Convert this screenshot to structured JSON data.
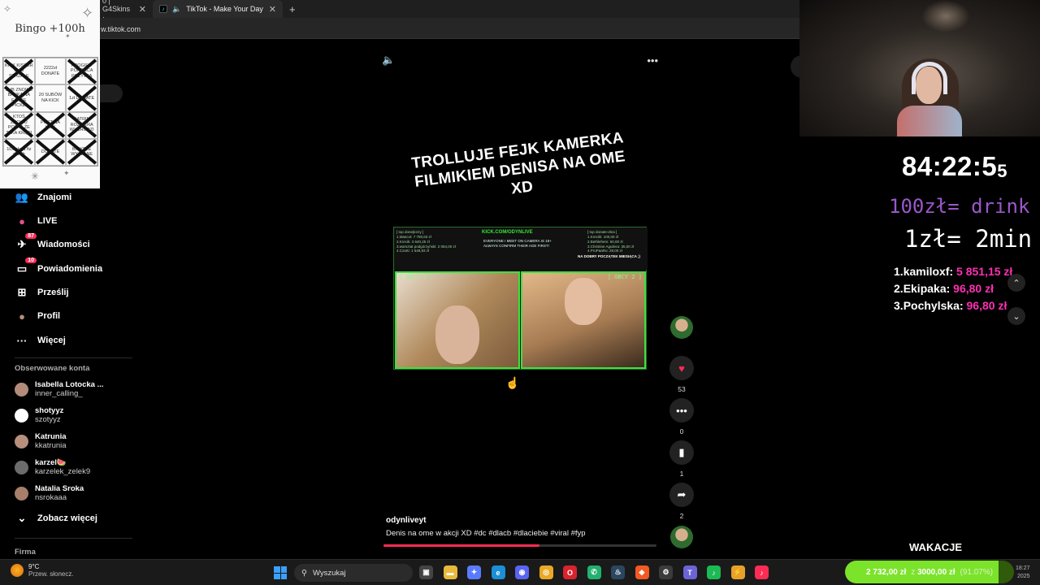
{
  "browser": {
    "tabs": [
      {
        "title": "0 | G4Skins ·",
        "active": false
      },
      {
        "title": "TikTok - Make Your Day",
        "active": true
      }
    ],
    "new_tab": "+",
    "url": "w.tiktok.com"
  },
  "bingo": {
    "title": "Bingo +100h",
    "cells": [
      {
        "text": "KICK KISSER O 10 STRZALE",
        "crossed": true
      },
      {
        "text": "2222zł DONATE",
        "crossed": false
      },
      {
        "text": "PROGIE 7 POKONCA POZYWIA",
        "crossed": true
      },
      {
        "text": "SUB ZNOWU BAŃKA NA FANCE PICKE",
        "crossed": true
      },
      {
        "text": "20 SUBÓW NA KICK",
        "crossed": false
      },
      {
        "text": "1zł DONATE",
        "crossed": true
      },
      {
        "text": "KTOŚ ZNOWU POWIE ŻE TAKA KRĘCI",
        "crossed": true
      },
      {
        "text": "POST NA KICK",
        "crossed": true
      },
      {
        "text": "KATRIN ROZBIERA WYCHODZI",
        "crossed": true
      },
      {
        "text": "10x akcja fiz dla lib",
        "crossed": true
      },
      {
        "text": "DONATE",
        "crossed": true
      },
      {
        "text": "BICYSLE WYSŁANE",
        "crossed": true
      }
    ]
  },
  "sidebar": {
    "nav": [
      {
        "label": "Znajomi",
        "icon": "friends-icon",
        "glyph": "👥",
        "badge": ""
      },
      {
        "label": "LIVE",
        "icon": "live-icon",
        "glyph": "●",
        "badge": ""
      },
      {
        "label": "Wiadomości",
        "icon": "messages-icon",
        "glyph": "✈",
        "badge": "87"
      },
      {
        "label": "Powiadomienia",
        "icon": "inbox-icon",
        "glyph": "▭",
        "badge": "10"
      },
      {
        "label": "Prześlij",
        "icon": "upload-icon",
        "glyph": "⊞",
        "badge": ""
      },
      {
        "label": "Profil",
        "icon": "profile-icon",
        "glyph": "●",
        "badge": ""
      },
      {
        "label": "Więcej",
        "icon": "more-icon",
        "glyph": "···",
        "badge": ""
      }
    ],
    "following_title": "Obserwowane konta",
    "following": [
      {
        "name": "Isabella Lotocka ...",
        "handle": "inner_calling_",
        "color": "#b48b7a"
      },
      {
        "name": "shotyyz",
        "handle": "szotyyz",
        "color": "#ffffff"
      },
      {
        "name": "Katrunia",
        "handle": "kkatrunia",
        "color": "#b78f7d"
      },
      {
        "name": "karzel🍉",
        "handle": "karzelek_zelek9",
        "color": "#6c6c6c"
      },
      {
        "name": "Natalia Sroka",
        "handle": "nsrokaaa",
        "color": "#a77f6a"
      }
    ],
    "see_more": "Zobacz więcej",
    "company": "Firma"
  },
  "video": {
    "headline": "TROLLUJE FEJK KAMERKA FILMIKIEM DENISA NA OME XD",
    "inner": {
      "kick_banner": "KICK.COM/ODYNLIVE",
      "left_board": "[ top donejtorzy ]\n1.Mascot: 7 790,63 zł\n2.Krecik: 3 640,25 zł\n3.warsztat podgórzyński: 2 054,00 zł\n4.Czarti: 1 549,83 zł",
      "right_board": "[ top donate-dnia ]\n1.Kreciik: 100,00 zł\n2.Bethlehem: 60,00 zł\n3.Christine Aguilera: 35,00 zł\n4.ProPaaRo: 28,00 zł",
      "notice": "EVERYONE I MEET ON CAMERA IS 18+\nALWAYS CONFIRM THEIR AGE FIRST!",
      "mission": "NA DOBRY POCZĄTEK MIESIĄCA ;)",
      "cam_left": "[ OBCY 1 ]",
      "cam_right": "[ OBCY 2 ]"
    },
    "author": "odynliveyt",
    "caption": "Denis na ome w akcji XD #dc  #dlacb  #dlaciebie  #viral  #fyp",
    "progress": 0.57
  },
  "actions": [
    {
      "name": "like",
      "icon": "heart-icon",
      "glyph": "♥",
      "count": "53"
    },
    {
      "name": "comment",
      "icon": "comment-icon",
      "glyph": "•••",
      "count": "0"
    },
    {
      "name": "save",
      "icon": "bookmark-icon",
      "glyph": "▮",
      "count": "1"
    },
    {
      "name": "share",
      "icon": "share-icon",
      "glyph": "➦",
      "count": "2"
    }
  ],
  "stream": {
    "timer": "84:22:5",
    "timer_tail": "5",
    "drink_line": "100zł= drink",
    "rate_line": "1zł= 2min",
    "top": [
      {
        "rank": "1.",
        "name": "kamiloxf:",
        "amount": "5 851,15 zł"
      },
      {
        "rank": "2.",
        "name": "Ekipaka:",
        "amount": "96,80 zł"
      },
      {
        "rank": "3.",
        "name": "Pochylska:",
        "amount": "96,80 zł"
      }
    ],
    "wakacje": "WAKACJE",
    "goal": {
      "raised": "2 732,00 zł",
      "of": "z",
      "target": "3000,00 zł",
      "percent_label": "(91.07%)",
      "fraction": 0.9107
    }
  },
  "taskbar": {
    "temp": "9°C",
    "weather_desc": "Przew. słonecz.",
    "search_placeholder": "Wyszukaj",
    "apps": [
      {
        "name": "task-view",
        "color": "#444",
        "glyph": "▣"
      },
      {
        "name": "file-explorer",
        "color": "#e8b93c",
        "glyph": "▬"
      },
      {
        "name": "copilot",
        "color": "#5a7bff",
        "glyph": "✦"
      },
      {
        "name": "edge",
        "color": "#1b8fd8",
        "glyph": "e"
      },
      {
        "name": "discord",
        "color": "#5865f2",
        "glyph": "◉"
      },
      {
        "name": "chrome",
        "color": "#e9a825",
        "glyph": "◎"
      },
      {
        "name": "opera",
        "color": "#d9232e",
        "glyph": "O"
      },
      {
        "name": "whatsapp",
        "color": "#23b16f",
        "glyph": "✆"
      },
      {
        "name": "steam",
        "color": "#2a475e",
        "glyph": "♨"
      },
      {
        "name": "brave",
        "color": "#f25a22",
        "glyph": "◆"
      },
      {
        "name": "settings",
        "color": "#3b3b3b",
        "glyph": "⚙"
      },
      {
        "name": "teams",
        "color": "#6b63d6",
        "glyph": "T"
      },
      {
        "name": "spotify",
        "color": "#1db954",
        "glyph": "♪"
      },
      {
        "name": "winamp",
        "color": "#e6a12b",
        "glyph": "⚡"
      },
      {
        "name": "tiktok",
        "color": "#fe2c55",
        "glyph": "♪"
      }
    ],
    "time": "18:27",
    "date": "2025"
  }
}
